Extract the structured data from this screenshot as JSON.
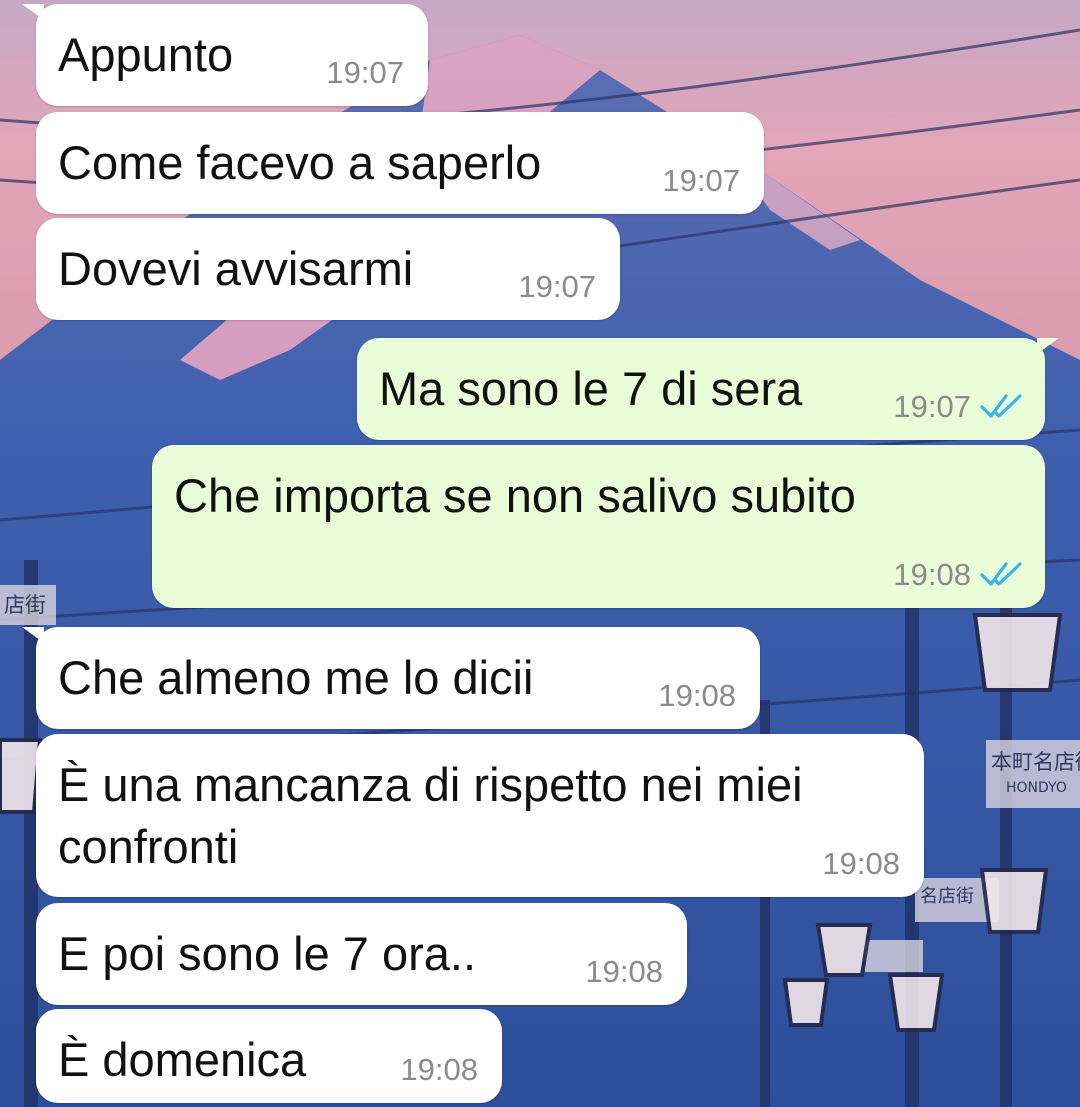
{
  "messages": [
    {
      "text": "Appunto",
      "time": "19:07",
      "direction": "incoming"
    },
    {
      "text": "Come facevo a saperlo",
      "time": "19:07",
      "direction": "incoming"
    },
    {
      "text": "Dovevi avvisarmi",
      "time": "19:07",
      "direction": "incoming"
    },
    {
      "text": "Ma sono le 7 di sera",
      "time": "19:07",
      "direction": "outgoing",
      "read_receipt": "double-check-icon"
    },
    {
      "text": "Che importa se non salivo subito",
      "time": "19:08",
      "direction": "outgoing",
      "read_receipt": "double-check-icon"
    },
    {
      "text": "Che almeno me lo dicii",
      "time": "19:08",
      "direction": "incoming"
    },
    {
      "text": "È una mancanza di rispetto nei miei\nconfronti",
      "time": "19:08",
      "direction": "incoming"
    },
    {
      "text": "E poi sono le 7 ora..",
      "time": "19:08",
      "direction": "incoming"
    },
    {
      "text": "È domenica",
      "time": "19:08",
      "direction": "incoming"
    }
  ],
  "wallpaper": {
    "signs": [
      "店街",
      "本町名店街",
      "HONDYO",
      "名店街"
    ]
  },
  "colors": {
    "incoming_bubble": "#ffffff",
    "outgoing_bubble": "#e9fdd8",
    "timestamp": "#8b8b8b",
    "read_tick": "#34b7f1"
  }
}
